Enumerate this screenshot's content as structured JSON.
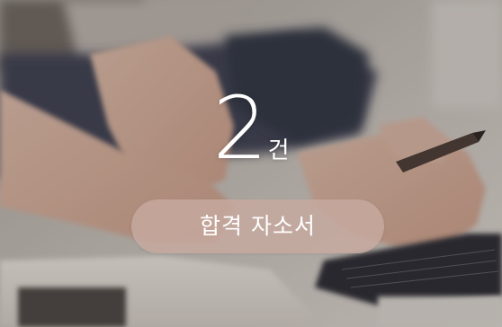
{
  "card": {
    "count_value": "2",
    "count_unit": "건",
    "button_label": "합격 자소서"
  },
  "colors": {
    "pill_background": "#c7aaa0",
    "text": "#ffffff"
  },
  "background_image": {
    "subject": "hands-writing-near-laptop-photo"
  }
}
